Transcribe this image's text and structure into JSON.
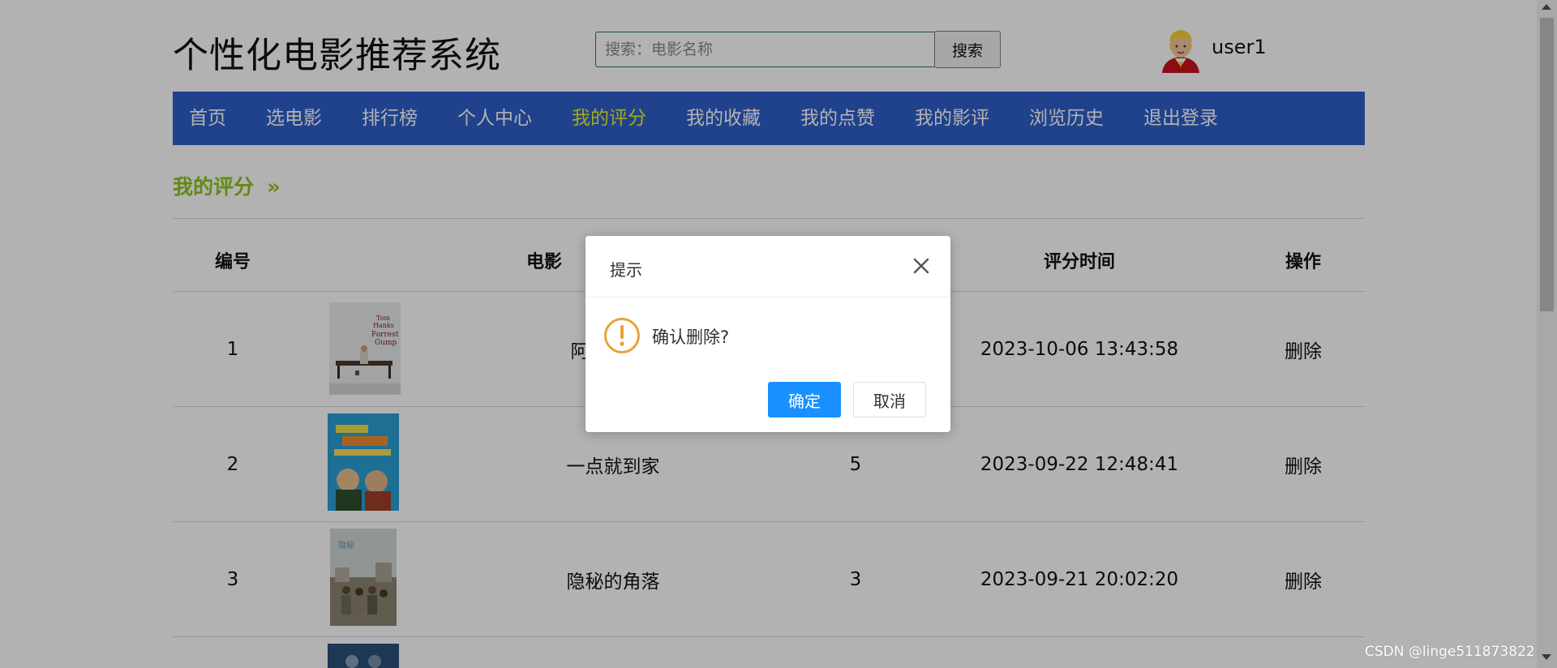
{
  "header": {
    "site_title": "个性化电影推荐系统",
    "search_placeholder": "搜索：电影名称",
    "search_button": "搜索",
    "username": "user1"
  },
  "nav": {
    "items": [
      {
        "label": "首页",
        "active": false
      },
      {
        "label": "选电影",
        "active": false
      },
      {
        "label": "排行榜",
        "active": false
      },
      {
        "label": "个人中心",
        "active": false
      },
      {
        "label": "我的评分",
        "active": true
      },
      {
        "label": "我的收藏",
        "active": false
      },
      {
        "label": "我的点赞",
        "active": false
      },
      {
        "label": "我的影评",
        "active": false
      },
      {
        "label": "浏览历史",
        "active": false
      },
      {
        "label": "退出登录",
        "active": false
      }
    ]
  },
  "breadcrumb": {
    "label": "我的评分",
    "arrow": "»"
  },
  "table": {
    "headers": [
      "编号",
      "电影",
      "评分时间",
      "操作"
    ],
    "rows": [
      {
        "id": "1",
        "title_partial": "阿",
        "score": "",
        "time": "2023-10-06 13:43:58",
        "action": "删除"
      },
      {
        "id": "2",
        "title": "一点就到家",
        "score": "5",
        "time": "2023-09-22 12:48:41",
        "action": "删除"
      },
      {
        "id": "3",
        "title": "隐秘的角落",
        "score": "3",
        "time": "2023-09-21 20:02:20",
        "action": "删除"
      }
    ]
  },
  "dialog": {
    "title": "提示",
    "message": "确认删除?",
    "confirm": "确定",
    "cancel": "取消"
  },
  "watermark": "CSDN @linge511873822",
  "colors": {
    "nav_bg": "#2e5fca",
    "nav_active": "#ecf32c",
    "breadcrumb": "#8ec41b",
    "primary_button": "#1a90ff",
    "warning": "#e6a23c"
  }
}
